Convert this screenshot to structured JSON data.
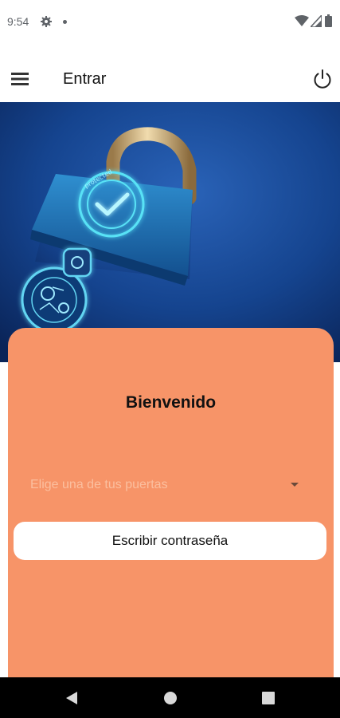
{
  "status_bar": {
    "time": "9:54",
    "icons": [
      "gear-icon",
      "notification-dot",
      "wifi-icon",
      "signal-icon",
      "battery-icon"
    ]
  },
  "app_bar": {
    "title": "Entrar",
    "menu_icon": "menu-icon",
    "power_icon": "power-icon"
  },
  "hero": {
    "lock_text": "protected"
  },
  "card": {
    "title": "Bienvenido",
    "dropdown_placeholder": "Elige una de tus puertas",
    "password_button": "Escribir contraseña"
  },
  "nav_bar": {
    "icons": [
      "back-icon",
      "home-icon",
      "recents-icon"
    ]
  },
  "colors": {
    "card": "#f79468",
    "hero_background": "#123a7a",
    "hero_glow": "#39d6f0"
  }
}
